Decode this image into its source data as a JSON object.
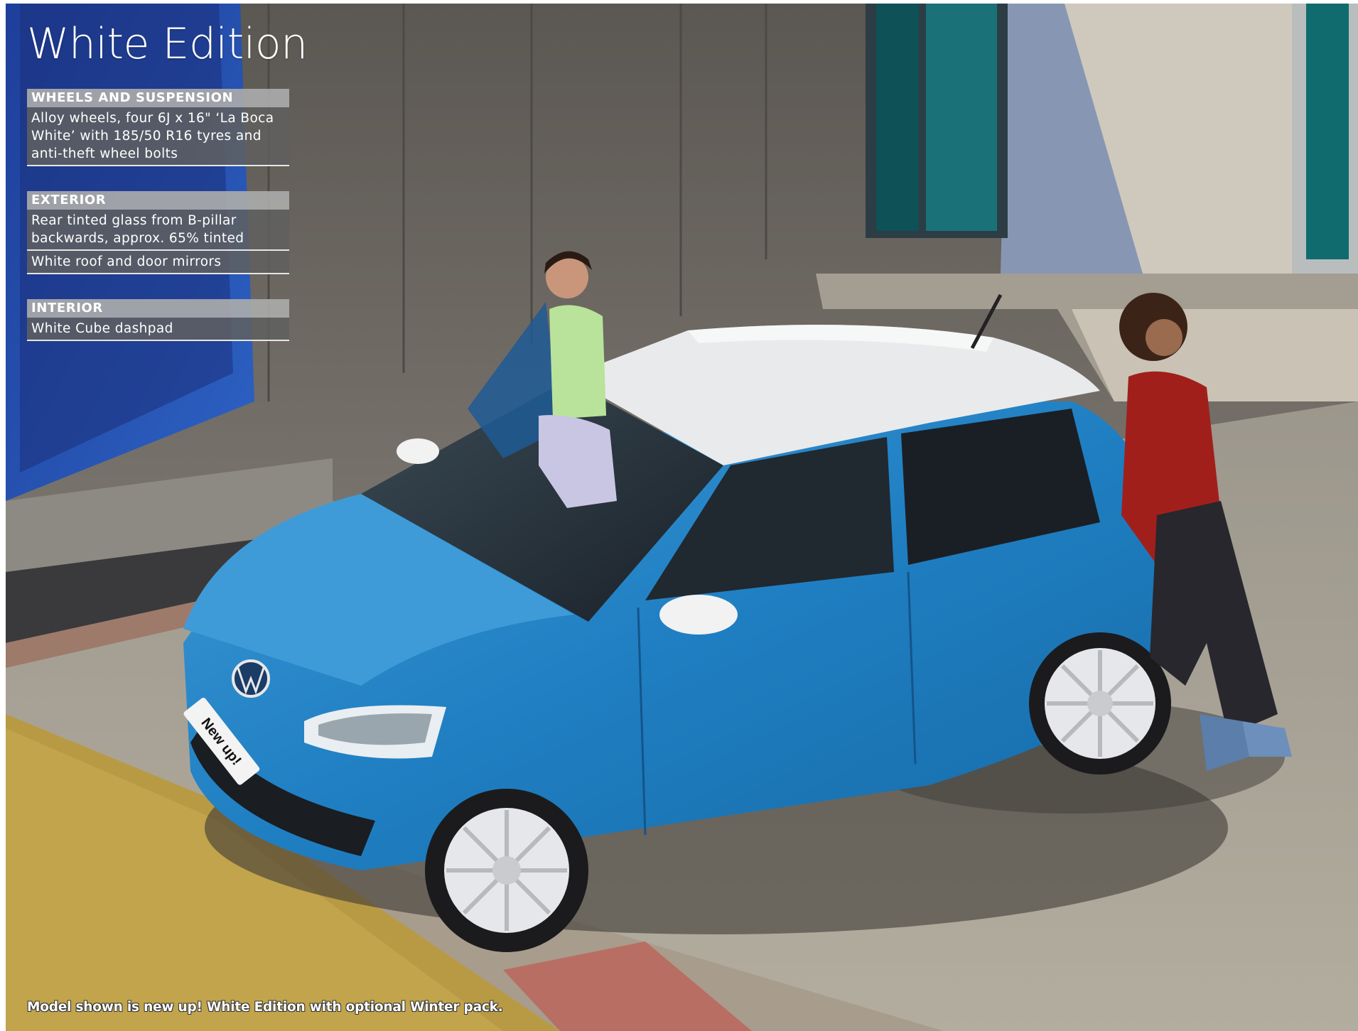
{
  "page": {
    "title": "White Edition",
    "caption": "Model shown is new up! White Edition with optional Winter pack.",
    "plate_text": "New up!"
  },
  "sections": [
    {
      "heading": "WHEELS AND SUSPENSION",
      "items": [
        "Alloy wheels, four 6J x 16\" ‘La Boca White’ with 185/50 R16 tyres and anti-theft wheel bolts"
      ]
    },
    {
      "heading": "EXTERIOR",
      "items": [
        "Rear tinted glass from B-pillar backwards, approx. 65% tinted",
        "White roof and door mirrors"
      ]
    },
    {
      "heading": "INTERIOR",
      "items": [
        "White Cube dashpad"
      ]
    }
  ],
  "colors": {
    "car_body": "#1f7fc2",
    "car_roof": "#e9eaec",
    "wall": "#6e6a64",
    "panel_heading": "#a9a9a9",
    "panel_body": "#5c5c5c"
  }
}
